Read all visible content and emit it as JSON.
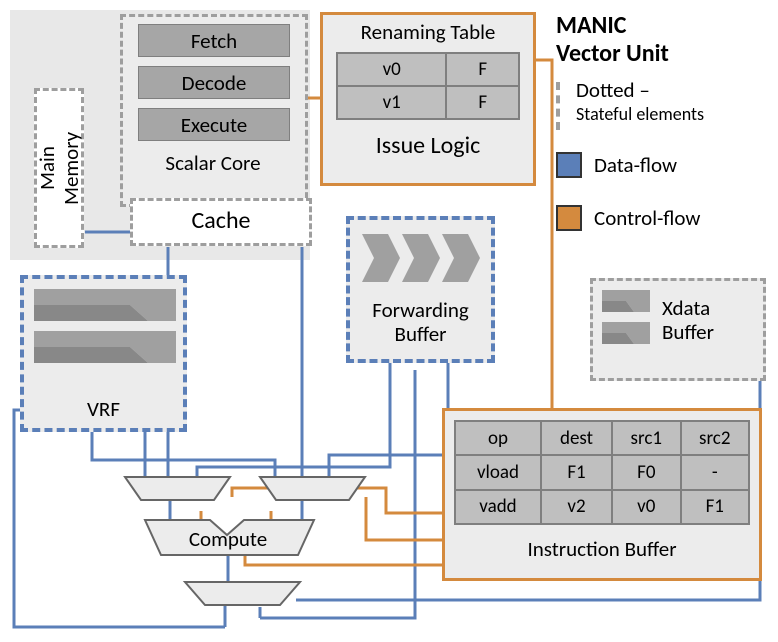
{
  "title": "MANIC\nVector Unit",
  "legend": {
    "dotted": "Dotted –",
    "dotted_sub": "Stateful elements",
    "data": "Data-flow",
    "control": "Control-flow"
  },
  "scalar": {
    "fetch": "Fetch",
    "decode": "Decode",
    "execute": "Execute",
    "label": "Scalar Core",
    "cache": "Cache",
    "mainmem": "Main\nMemory"
  },
  "issue": {
    "heading": "Renaming Table",
    "rows": [
      {
        "reg": "v0",
        "state": "F"
      },
      {
        "reg": "v1",
        "state": "F"
      }
    ],
    "label": "Issue Logic"
  },
  "vrf": "VRF",
  "fwd": "Forwarding\nBuffer",
  "xdata": "Xdata\nBuffer",
  "compute": "Compute",
  "instrbuf": {
    "cols": [
      "op",
      "dest",
      "src1",
      "src2"
    ],
    "rows": [
      [
        "vload",
        "F1",
        "F0",
        "-"
      ],
      [
        "vadd",
        "v2",
        "v0",
        "F1"
      ]
    ],
    "label": "Instruction Buffer"
  }
}
